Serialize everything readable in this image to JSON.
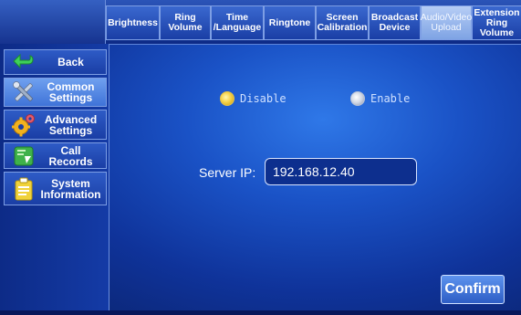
{
  "tabs": [
    {
      "label": "Brightness",
      "active": false
    },
    {
      "label": "Ring\nVolume",
      "active": false
    },
    {
      "label": "Time\n/Language",
      "active": false
    },
    {
      "label": "Ringtone",
      "active": false
    },
    {
      "label": "Screen\nCalibration",
      "active": false
    },
    {
      "label": "Broadcast\nDevice",
      "active": false
    },
    {
      "label": "Audio/Video\nUpload",
      "active": true
    },
    {
      "label": "Extension\nRing Volume",
      "active": false
    }
  ],
  "sidebar": {
    "items": [
      {
        "label": "Back",
        "icon": "back-arrow-icon",
        "active": false
      },
      {
        "label": "Common\nSettings",
        "icon": "tools-icon",
        "active": true
      },
      {
        "label": "Advanced\nSettings",
        "icon": "gears-icon",
        "active": false
      },
      {
        "label": "Call Records",
        "icon": "call-records-icon",
        "active": false
      },
      {
        "label": "System\nInformation",
        "icon": "clipboard-icon",
        "active": false
      }
    ]
  },
  "main": {
    "options": [
      {
        "label": "Disable",
        "selected": true
      },
      {
        "label": "Enable",
        "selected": false
      }
    ],
    "server_ip_label": "Server IP:",
    "server_ip_value": "192.168.12.40",
    "confirm_label": "Confirm"
  },
  "colors": {
    "background": "#1a52c6",
    "accent_selected": "#f5d24a",
    "border": "#7d9ee4"
  }
}
